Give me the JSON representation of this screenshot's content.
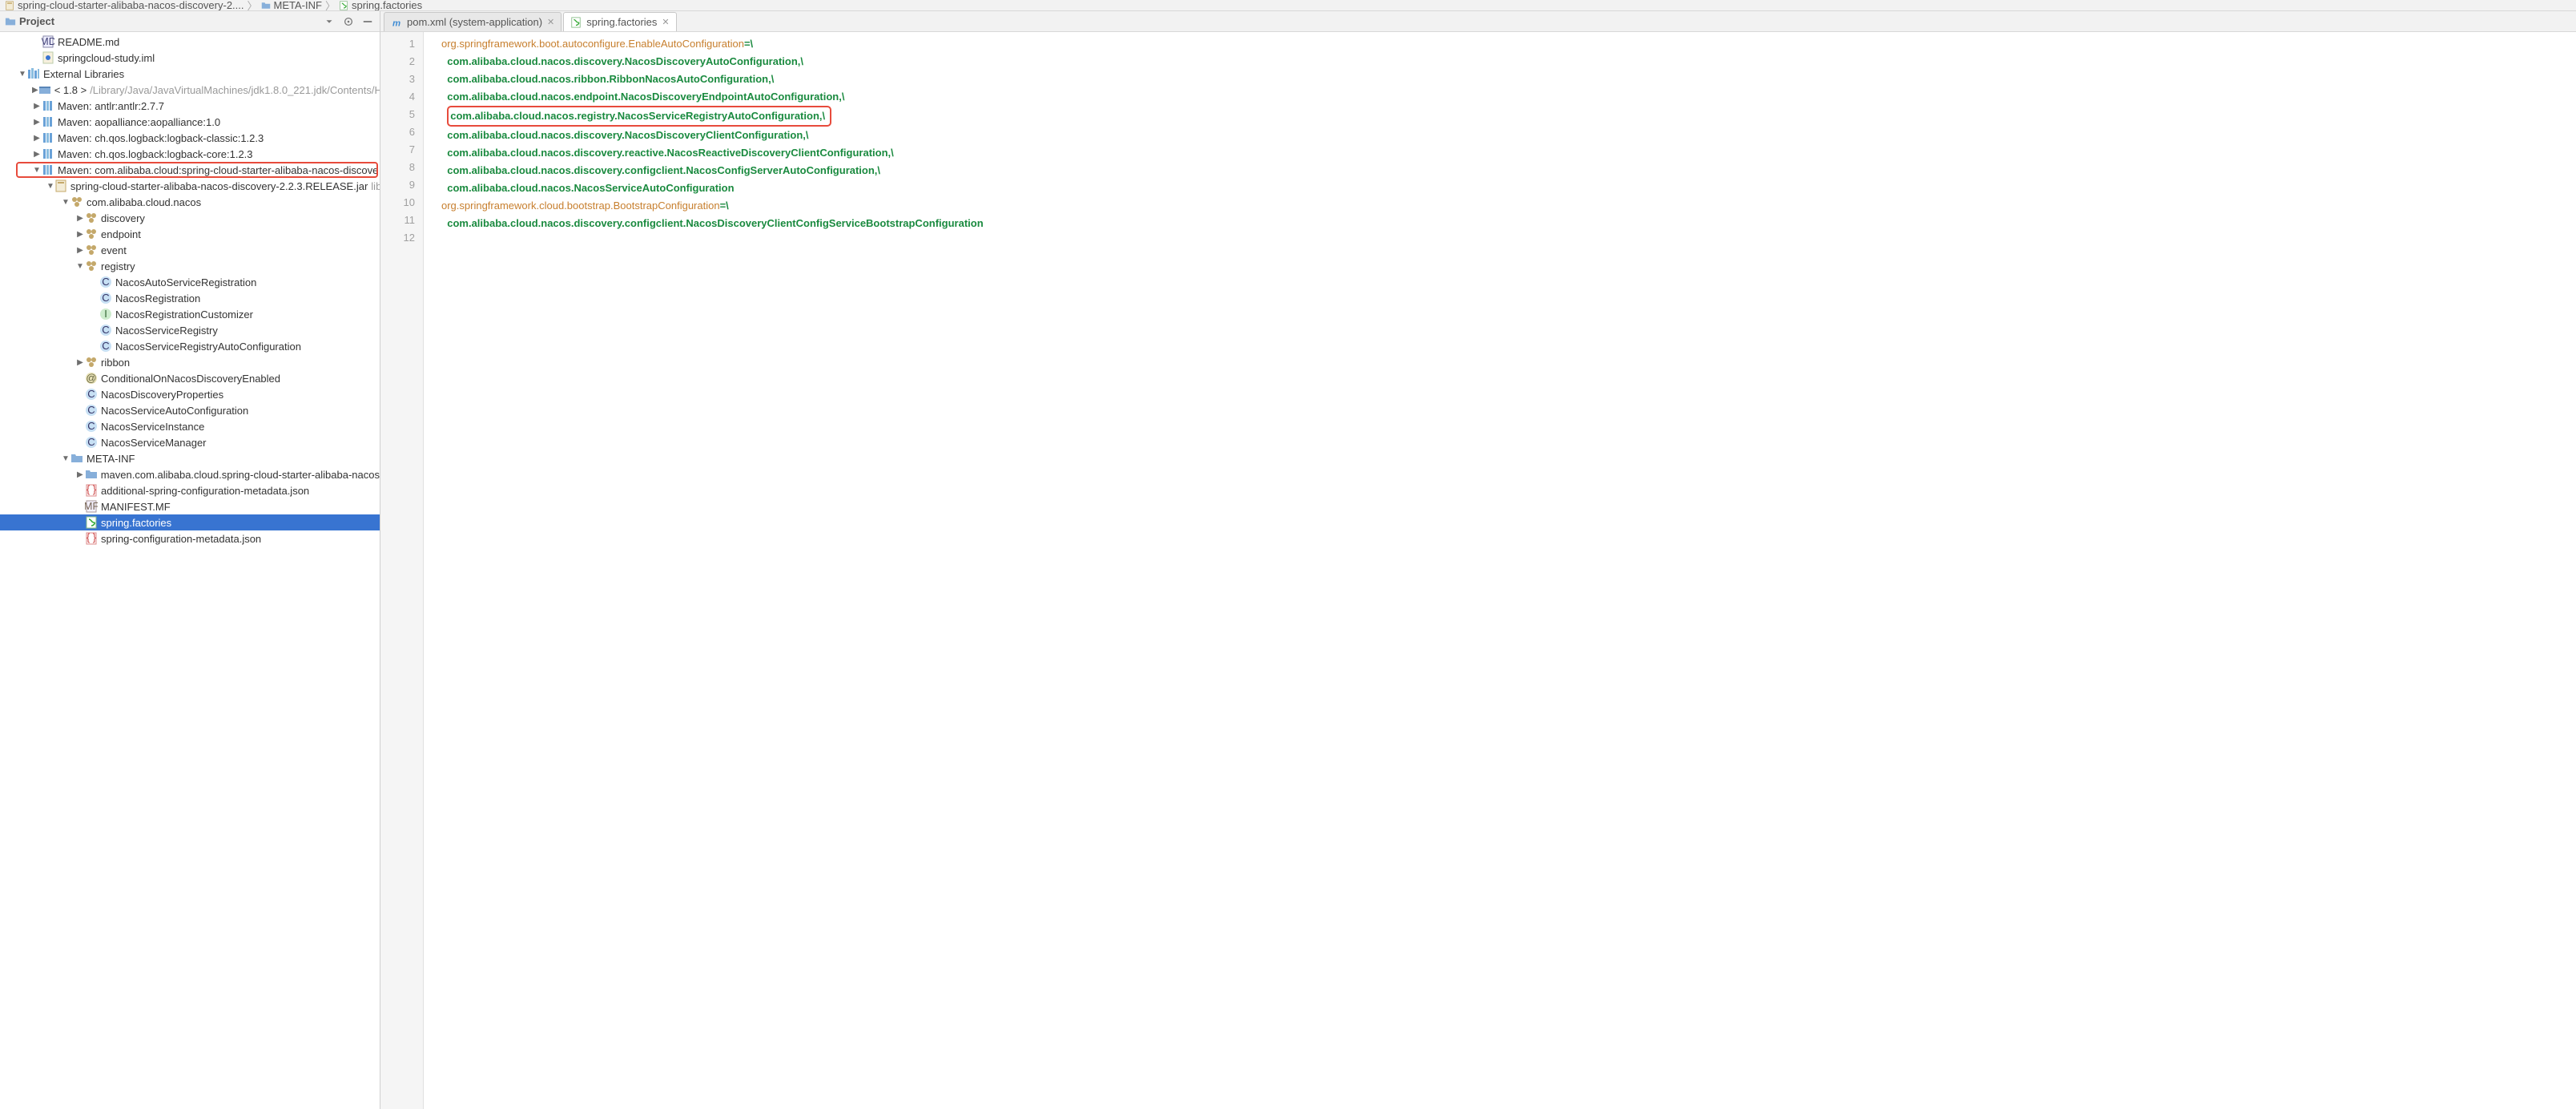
{
  "breadcrumbs": [
    {
      "icon": "jar",
      "text": "spring-cloud-starter-alibaba-nacos-discovery-2...."
    },
    {
      "icon": "folder",
      "text": "META-INF"
    },
    {
      "icon": "sf",
      "text": "spring.factories"
    }
  ],
  "project_panel": {
    "title": "Project",
    "tools": [
      "dropdown",
      "settings",
      "collapse"
    ]
  },
  "tree": [
    {
      "indent": 1,
      "arrow": "",
      "icon": "md",
      "label": "README.md"
    },
    {
      "indent": 1,
      "arrow": "",
      "icon": "iml",
      "label": "springcloud-study.iml"
    },
    {
      "indent": 0,
      "arrow": "down",
      "icon": "libs",
      "label": "External Libraries"
    },
    {
      "indent": 1,
      "arrow": "right",
      "icon": "jdk",
      "label": "< 1.8 >",
      "suffix": " /Library/Java/JavaVirtualMachines/jdk1.8.0_221.jdk/Contents/H"
    },
    {
      "indent": 1,
      "arrow": "right",
      "icon": "lib",
      "label": "Maven: antlr:antlr:2.7.7"
    },
    {
      "indent": 1,
      "arrow": "right",
      "icon": "lib",
      "label": "Maven: aopalliance:aopalliance:1.0"
    },
    {
      "indent": 1,
      "arrow": "right",
      "icon": "lib",
      "label": "Maven: ch.qos.logback:logback-classic:1.2.3"
    },
    {
      "indent": 1,
      "arrow": "right",
      "icon": "lib",
      "label": "Maven: ch.qos.logback:logback-core:1.2.3"
    },
    {
      "indent": 1,
      "arrow": "down",
      "icon": "lib",
      "label": "Maven: com.alibaba.cloud:spring-cloud-starter-alibaba-nacos-discove",
      "hl": true
    },
    {
      "indent": 2,
      "arrow": "down",
      "icon": "jar",
      "label": "spring-cloud-starter-alibaba-nacos-discovery-2.2.3.RELEASE.jar",
      "suffix": " lib"
    },
    {
      "indent": 3,
      "arrow": "down",
      "icon": "pkg",
      "label": "com.alibaba.cloud.nacos"
    },
    {
      "indent": 4,
      "arrow": "right",
      "icon": "pkg",
      "label": "discovery"
    },
    {
      "indent": 4,
      "arrow": "right",
      "icon": "pkg",
      "label": "endpoint"
    },
    {
      "indent": 4,
      "arrow": "right",
      "icon": "pkg",
      "label": "event"
    },
    {
      "indent": 4,
      "arrow": "down",
      "icon": "pkg",
      "label": "registry"
    },
    {
      "indent": 5,
      "arrow": "",
      "icon": "cls",
      "label": "NacosAutoServiceRegistration"
    },
    {
      "indent": 5,
      "arrow": "",
      "icon": "cls",
      "label": "NacosRegistration"
    },
    {
      "indent": 5,
      "arrow": "",
      "icon": "int",
      "label": "NacosRegistrationCustomizer"
    },
    {
      "indent": 5,
      "arrow": "",
      "icon": "cls",
      "label": "NacosServiceRegistry"
    },
    {
      "indent": 5,
      "arrow": "",
      "icon": "cls",
      "label": "NacosServiceRegistryAutoConfiguration"
    },
    {
      "indent": 4,
      "arrow": "right",
      "icon": "pkg",
      "label": "ribbon"
    },
    {
      "indent": 4,
      "arrow": "",
      "icon": "ann",
      "label": "ConditionalOnNacosDiscoveryEnabled"
    },
    {
      "indent": 4,
      "arrow": "",
      "icon": "cls",
      "label": "NacosDiscoveryProperties"
    },
    {
      "indent": 4,
      "arrow": "",
      "icon": "cls",
      "label": "NacosServiceAutoConfiguration"
    },
    {
      "indent": 4,
      "arrow": "",
      "icon": "cls",
      "label": "NacosServiceInstance"
    },
    {
      "indent": 4,
      "arrow": "",
      "icon": "cls",
      "label": "NacosServiceManager"
    },
    {
      "indent": 3,
      "arrow": "down",
      "icon": "folder",
      "label": "META-INF"
    },
    {
      "indent": 4,
      "arrow": "right",
      "icon": "folder",
      "label": "maven.com.alibaba.cloud.spring-cloud-starter-alibaba-nacos"
    },
    {
      "indent": 4,
      "arrow": "",
      "icon": "json",
      "label": "additional-spring-configuration-metadata.json"
    },
    {
      "indent": 4,
      "arrow": "",
      "icon": "mf",
      "label": "MANIFEST.MF"
    },
    {
      "indent": 4,
      "arrow": "",
      "icon": "sf",
      "label": "spring.factories",
      "selected": true
    },
    {
      "indent": 4,
      "arrow": "",
      "icon": "json",
      "label": "spring-configuration-metadata.json"
    }
  ],
  "tabs": [
    {
      "icon": "xml",
      "label": "pom.xml (system-application)",
      "active": false
    },
    {
      "icon": "sf",
      "label": "spring.factories",
      "active": true
    }
  ],
  "code_lines": [
    {
      "n": 1,
      "indent": 0,
      "text": "org.springframework.boot.autoconfigure.EnableAutoConfiguration=\\"
    },
    {
      "n": 2,
      "indent": 1,
      "text": "com.alibaba.cloud.nacos.discovery.NacosDiscoveryAutoConfiguration,\\"
    },
    {
      "n": 3,
      "indent": 1,
      "text": "com.alibaba.cloud.nacos.ribbon.RibbonNacosAutoConfiguration,\\"
    },
    {
      "n": 4,
      "indent": 1,
      "text": "com.alibaba.cloud.nacos.endpoint.NacosDiscoveryEndpointAutoConfiguration,\\"
    },
    {
      "n": 5,
      "indent": 1,
      "text": "com.alibaba.cloud.nacos.registry.NacosServiceRegistryAutoConfiguration,\\",
      "hl": true
    },
    {
      "n": 6,
      "indent": 1,
      "text": "com.alibaba.cloud.nacos.discovery.NacosDiscoveryClientConfiguration,\\"
    },
    {
      "n": 7,
      "indent": 1,
      "text": "com.alibaba.cloud.nacos.discovery.reactive.NacosReactiveDiscoveryClientConfiguration,\\"
    },
    {
      "n": 8,
      "indent": 1,
      "text": "com.alibaba.cloud.nacos.discovery.configclient.NacosConfigServerAutoConfiguration,\\"
    },
    {
      "n": 9,
      "indent": 1,
      "text": "com.alibaba.cloud.nacos.NacosServiceAutoConfiguration"
    },
    {
      "n": 10,
      "indent": 0,
      "text": "org.springframework.cloud.bootstrap.BootstrapConfiguration=\\"
    },
    {
      "n": 11,
      "indent": 1,
      "text": "com.alibaba.cloud.nacos.discovery.configclient.NacosDiscoveryClientConfigServiceBootstrapConfiguration"
    },
    {
      "n": 12,
      "indent": 0,
      "text": "",
      "current": true
    }
  ]
}
